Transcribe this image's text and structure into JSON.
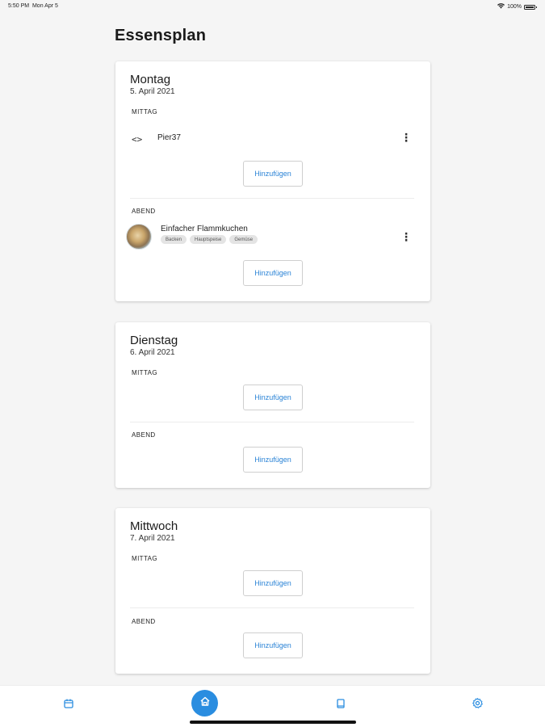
{
  "status_bar": {
    "time": "5:50 PM",
    "date": "Mon Apr 5",
    "battery": "100%"
  },
  "page": {
    "title": "Essensplan"
  },
  "days": [
    {
      "name": "Montag",
      "date": "5. April 2021",
      "lunch_label": "MITTAG",
      "lunch_item": "Pier37",
      "dinner_label": "ABEND",
      "dinner_item": "Einfacher Flammkuchen",
      "dinner_tags": [
        "Backen",
        "Hauptspeise",
        "Gemüse"
      ],
      "add_label": "Hinzufügen"
    },
    {
      "name": "Dienstag",
      "date": "6. April 2021",
      "lunch_label": "MITTAG",
      "dinner_label": "ABEND",
      "add_label": "Hinzufügen"
    },
    {
      "name": "Mittwoch",
      "date": "7. April 2021",
      "lunch_label": "MITTAG",
      "dinner_label": "ABEND",
      "add_label": "Hinzufügen"
    }
  ],
  "nav": {
    "items": [
      "calendar-icon",
      "home-icon",
      "book-icon",
      "settings-icon"
    ],
    "active": "home-icon"
  },
  "colors": {
    "accent": "#2a8de0",
    "button_text": "#2a83d6",
    "background": "#f5f5f5"
  }
}
